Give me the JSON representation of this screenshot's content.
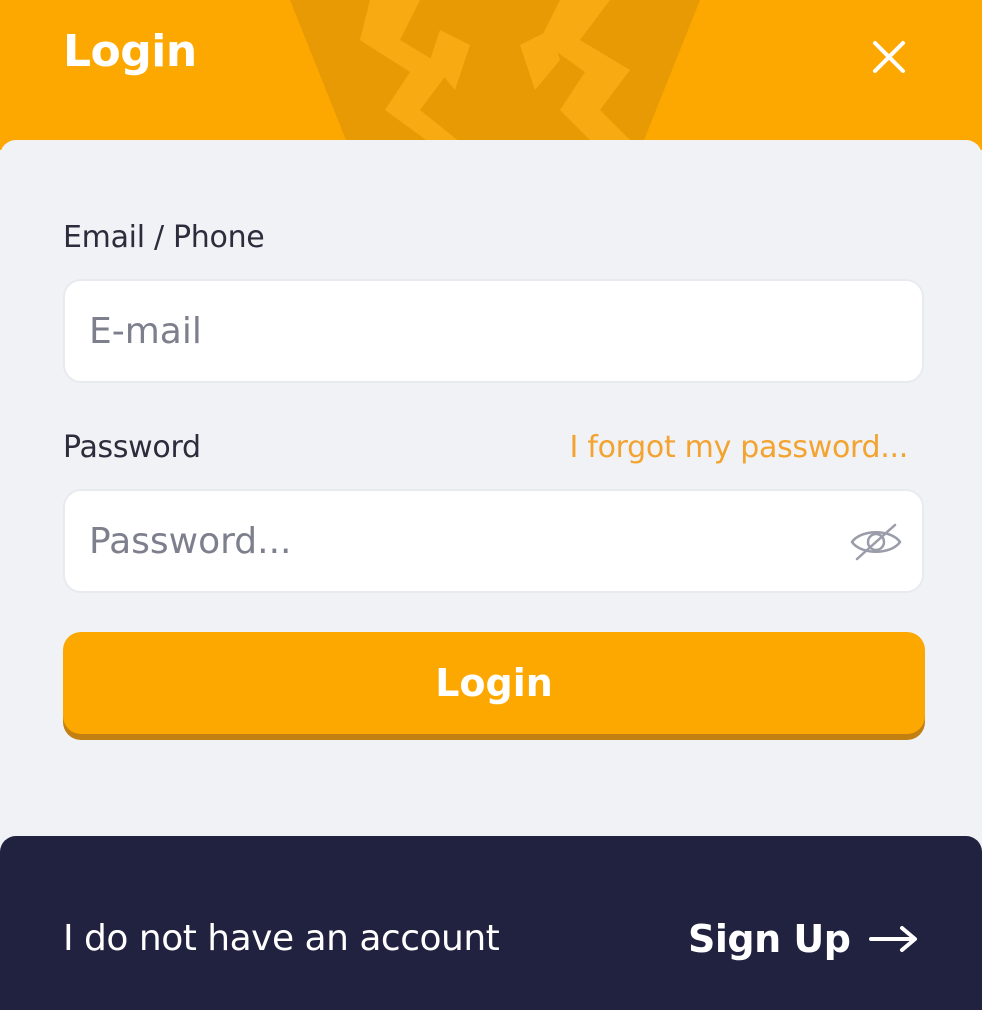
{
  "header": {
    "title": "Login",
    "close_icon": "close-icon",
    "emblem_icon": "lightning-emblem-icon"
  },
  "form": {
    "email_label": "Email / Phone",
    "email_placeholder": "E-mail",
    "email_value": "",
    "password_label": "Password",
    "forgot_link": "I forgot my password...",
    "password_placeholder": "Password...",
    "password_value": "",
    "visibility_icon": "eye-slash-icon",
    "submit_label": "Login"
  },
  "footer": {
    "prompt": "I do not have an account",
    "signup_label": "Sign Up",
    "arrow_icon": "arrow-right-icon"
  },
  "colors": {
    "accent": "#fca800",
    "accent_dark": "#c28012",
    "link": "#f2a330",
    "footer_bg": "#212140",
    "panel_bg": "#f1f2f6"
  }
}
